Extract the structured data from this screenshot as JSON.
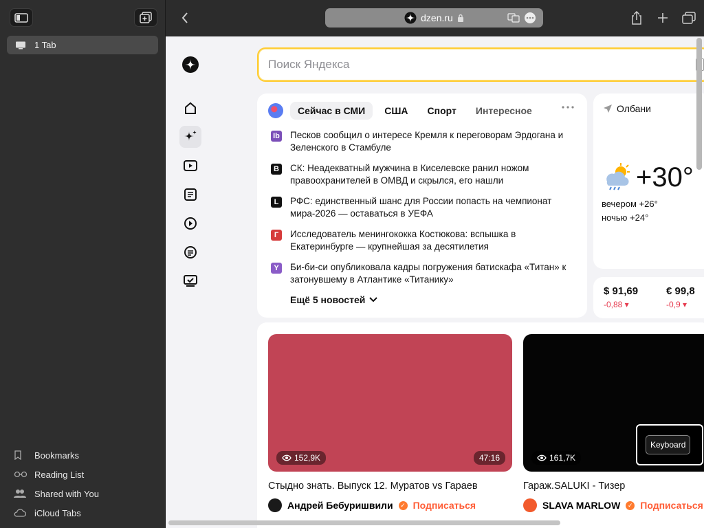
{
  "sidebar": {
    "tab_label": "1 Tab",
    "bottom_items": [
      {
        "label": "Bookmarks",
        "icon": "bookmark-icon"
      },
      {
        "label": "Reading List",
        "icon": "glasses-icon"
      },
      {
        "label": "Shared with You",
        "icon": "people-icon"
      },
      {
        "label": "iCloud Tabs",
        "icon": "cloud-icon"
      }
    ]
  },
  "toolbar": {
    "url": "dzen.ru"
  },
  "search": {
    "placeholder": "Поиск Яндекса"
  },
  "news": {
    "tabs": [
      "Сейчас в СМИ",
      "США",
      "Спорт",
      "Интересное"
    ],
    "items": [
      {
        "text": "Песков сообщил о интересе Кремля к переговорам Эрдогана и Зеленского в Стамбуле",
        "src_color": "#7b4fb8",
        "src_letter": "Ib"
      },
      {
        "text": "СК: Неадекватный мужчина в Киселевске ранил ножом правоохранителей в ОМВД и скрылся, его нашли",
        "src_color": "#111111",
        "src_letter": "B"
      },
      {
        "text": "РФС: единственный шанс для России попасть на чемпионат мира-2026 — оставаться в УЕФА",
        "src_color": "#111111",
        "src_letter": "L"
      },
      {
        "text": "Исследователь менингококка Костюкова: вспышка в Екатеринбурге — крупнейшая за десятилетия",
        "src_color": "#d63b3b",
        "src_letter": "Г"
      },
      {
        "text": "Би-би-си опубликовала кадры погружения батискафа «Титан» к затонувшему в Атлантике «Титанику»",
        "src_color": "#8a5cc7",
        "src_letter": "Y"
      }
    ],
    "more_label": "Ещё 5 новостей"
  },
  "weather": {
    "location": "Олбани",
    "temp": "+30°",
    "evening": "вечером +26°",
    "night": "ночью +24°"
  },
  "rates": [
    {
      "value": "$ 91,69",
      "change": "-0,88 ▾"
    },
    {
      "value": "€ 99,8",
      "change": "-0,9 ▾"
    }
  ],
  "videos": [
    {
      "views": "152,9K",
      "duration": "47:16",
      "title": "Стыдно знать. Выпуск 12. Муратов vs Гараев",
      "author": "Андрей Бебуришвили",
      "subscribe": "Подписаться",
      "bg": "#c14455",
      "avatar": "#1a1a1a"
    },
    {
      "views": "161,7K",
      "duration": "",
      "title": "Гараж.SALUKI - Тизер",
      "author": "SLAVA MARLOW",
      "subscribe": "Подписаться",
      "bg": "#050505",
      "avatar": "#f25a2c"
    }
  ],
  "keyboard_tip": "Keyboard"
}
